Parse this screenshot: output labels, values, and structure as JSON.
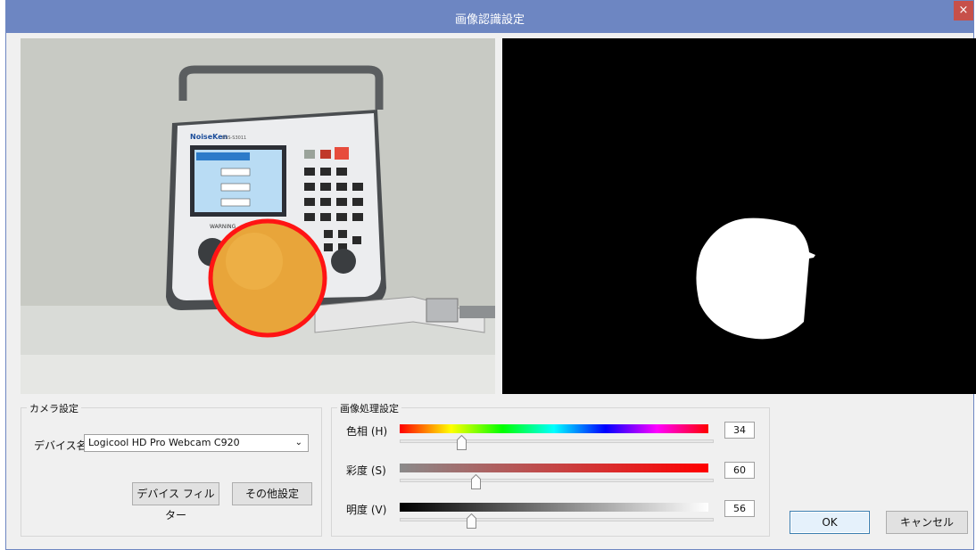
{
  "window": {
    "title": "画像認識設定",
    "close_glyph": "×"
  },
  "camera_group": {
    "legend": "カメラ設定",
    "device_label": "デバイス名",
    "device_value": "Logicool HD Pro Webcam C920",
    "filter_button": "デバイス フィルター",
    "other_button": "その他設定"
  },
  "processing_group": {
    "legend": "画像処理設定",
    "hue": {
      "label": "色相 (H)",
      "value": "34",
      "level": 34,
      "max": 180
    },
    "saturation": {
      "label": "彩度 (S)",
      "value": "60",
      "level": 60,
      "max": 255
    },
    "brightness": {
      "label": "明度 (V)",
      "value": "56",
      "level": 56,
      "max": 255
    }
  },
  "device_screen": {
    "brand": "NoiseKen",
    "model": "ESS-S3011",
    "warning": "WARNING"
  },
  "dialog_buttons": {
    "ok": "OK",
    "cancel": "キャンセル"
  },
  "colors": {
    "titlebar": "#6d86c2",
    "close": "#c7504a",
    "detect_circle": "#ff1414"
  },
  "icons": [
    "close-icon",
    "chevron-down-icon",
    "slider-thumb-icon"
  ]
}
